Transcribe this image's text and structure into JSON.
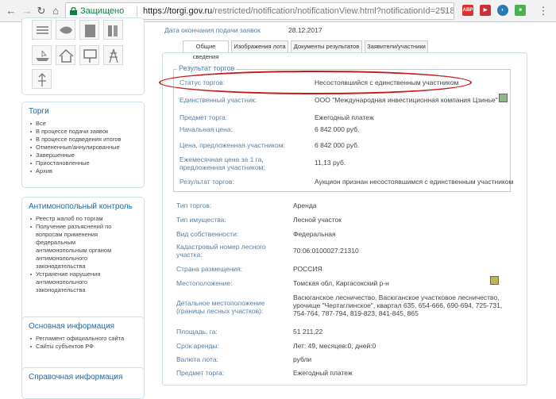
{
  "browser": {
    "secure_label": "Защищено",
    "url_host": "https://torgi.gov.ru",
    "url_path": "/restricted/notification/notificationView.html?notificationId=25185096…",
    "ext_abp": "ABP"
  },
  "sidebar": {
    "torgi": {
      "title": "Торги",
      "items": [
        "Все",
        "В процессе подачи заявок",
        "В процессе подведения итогов",
        "Отмененные/аннулированные",
        "Завершенные",
        "Приостановленные",
        "Архив"
      ]
    },
    "antimonopoly": {
      "title": "Антимонопольный контроль",
      "items": [
        "Реестр жалоб по торгам",
        "Получение разъяснений по вопросам применения федеральным антимонопольным органом антимонопольного законодательства",
        "Устранение нарушения антимонопольного законодательства"
      ]
    },
    "main_info": {
      "title": "Основная информация",
      "items": [
        "Регламент официального сайта",
        "Сайты субъектов РФ"
      ]
    },
    "reference": {
      "title": "Справочная информация"
    }
  },
  "header": {
    "deadline_label": "Дата окончания подачи заявок",
    "deadline_value": "28.12.2017"
  },
  "tabs": [
    "Общие сведения",
    "Изображения лота",
    "Документы результатов",
    "Заявители/участники"
  ],
  "results": {
    "legend": "Результат торгов",
    "rows": [
      {
        "label": "Статус торгов:",
        "value": "Несостоявшийся с единственным участником"
      },
      {
        "label": "Единственный участник:",
        "value": "ООО \"Международная инвестиционная компания Цзинье\""
      },
      {
        "label": "Предмет торга:",
        "value": "Ежегодный платеж"
      },
      {
        "label": "Начальная цена:",
        "value": "6 842 000 руб."
      },
      {
        "label": "Цена, предложенная участником:",
        "value": "6 842 000 руб."
      },
      {
        "label": "Ежемесячная цена за 1 га, предложенная участником:",
        "value": "11,13 руб."
      },
      {
        "label": "Результат торгов:",
        "value": "Аукцион признан несостоявшимся с единственным участником"
      }
    ]
  },
  "details": [
    {
      "label": "Тип торгов:",
      "value": "Аренда"
    },
    {
      "label": "Тип имущества:",
      "value": "Лесной участок"
    },
    {
      "label": "Вид собственности:",
      "value": "Федеральная"
    },
    {
      "label": "Кадастровый номер лесного участка:",
      "value": "70:06:0100027:21310"
    },
    {
      "label": "Страна размещения:",
      "value": "РОССИЯ"
    },
    {
      "label": "Местоположение:",
      "value": "Томская обл, Каргасокский р-н"
    },
    {
      "label": "Детальное местоположение (границы лесных участков):",
      "value": "Васюганское лесничество, Васюганское участковое лесничество, урочище \"Чертаглинское\", квартал 635, 654-666, 690-694, 725-731, 754-764, 787-794, 819-823, 841-845, 865"
    },
    {
      "label": "Площадь, га:",
      "value": "51 211,22"
    },
    {
      "label": "Срок аренды:",
      "value": "Лет: 49, месяцев:0, дней:0"
    },
    {
      "label": "Валюта лота:",
      "value": "рубли"
    },
    {
      "label": "Предмет торга:",
      "value": "Ежегодный платеж"
    }
  ],
  "colors": {
    "accent": "#1f6aa5",
    "label": "#5a7fa0",
    "highlight": "#c41a1a",
    "secure": "#0b8043"
  }
}
